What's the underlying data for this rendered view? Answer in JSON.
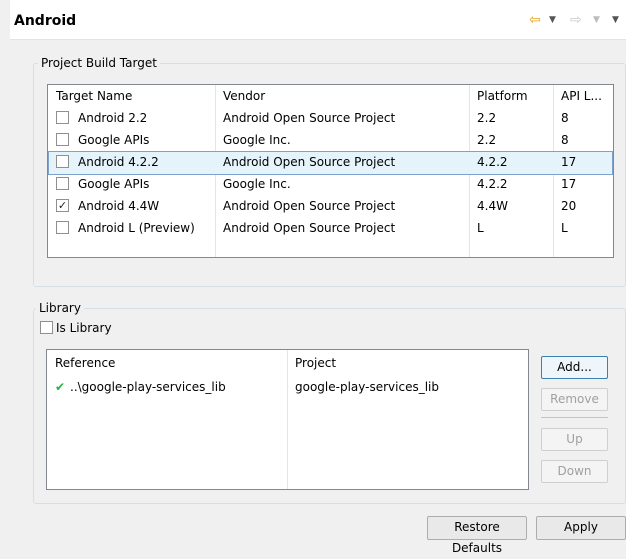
{
  "page_title": "Android",
  "nav": {
    "back_icon": "⇦",
    "forward_icon": "⇨",
    "dropdown_icon": "▼"
  },
  "build_target": {
    "group_label": "Project Build Target",
    "columns": [
      "Target Name",
      "Vendor",
      "Platform",
      "API L..."
    ],
    "rows": [
      {
        "name": "Android 2.2",
        "vendor": "Android Open Source Project",
        "platform": "2.2",
        "api": "8",
        "checked": false
      },
      {
        "name": "Google APIs",
        "vendor": "Google Inc.",
        "platform": "2.2",
        "api": "8",
        "checked": false
      },
      {
        "name": "Android 4.2.2",
        "vendor": "Android Open Source Project",
        "platform": "4.2.2",
        "api": "17",
        "checked": false,
        "selected": true
      },
      {
        "name": "Google APIs",
        "vendor": "Google Inc.",
        "platform": "4.2.2",
        "api": "17",
        "checked": false
      },
      {
        "name": "Android 4.4W",
        "vendor": "Android Open Source Project",
        "platform": "4.4W",
        "api": "20",
        "checked": true
      },
      {
        "name": "Android L (Preview)",
        "vendor": "Android Open Source Project",
        "platform": "L",
        "api": "L",
        "checked": false
      }
    ]
  },
  "library": {
    "group_label": "Library",
    "is_library_label": "Is Library",
    "is_library_checked": false,
    "columns": [
      "Reference",
      "Project"
    ],
    "rows": [
      {
        "status_icon": "✔",
        "reference": "..\\google-play-services_lib",
        "project": "google-play-services_lib"
      }
    ],
    "buttons": {
      "add": "Add...",
      "remove": "Remove",
      "up": "Up",
      "down": "Down"
    }
  },
  "footer": {
    "restore_defaults": "Restore Defaults",
    "apply": "Apply"
  }
}
